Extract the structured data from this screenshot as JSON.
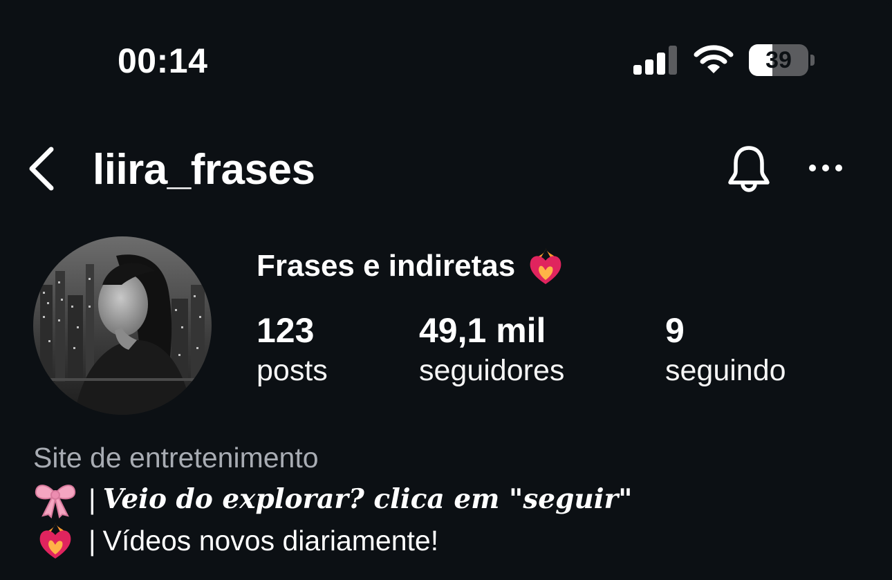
{
  "status_bar": {
    "time": "00:14",
    "signal_icon": "cellular-signal-icon",
    "wifi_icon": "wifi-icon",
    "battery_level": "39",
    "battery_fraction": 0.39
  },
  "header": {
    "back_icon": "chevron-left-icon",
    "username": "liira_frases",
    "notification_icon": "bell-icon",
    "more_icon": "more-horizontal-icon"
  },
  "profile": {
    "avatar_icon": "profile-avatar-image",
    "display_name": "Frases e indiretas",
    "display_name_emoji": "heart-on-fire-emoji",
    "stats": [
      {
        "value": "123",
        "label": "posts"
      },
      {
        "value": "49,1 mil",
        "label": "seguidores"
      },
      {
        "value": "9",
        "label": "seguindo"
      }
    ],
    "category": "Site de entretenimento",
    "bio": [
      {
        "emoji": "ribbon-emoji",
        "separator": "|",
        "text": "Veio do explorar? clica em \"seguir\""
      },
      {
        "emoji": "heart-on-fire-emoji",
        "separator": "|",
        "text": "Vídeos novos diariamente!"
      }
    ]
  },
  "colors": {
    "background": "#0c1014",
    "text_primary": "#ffffff",
    "text_secondary": "#a8acb3",
    "heart_red": "#e0245e",
    "ribbon_pink": "#f4a6c1"
  }
}
